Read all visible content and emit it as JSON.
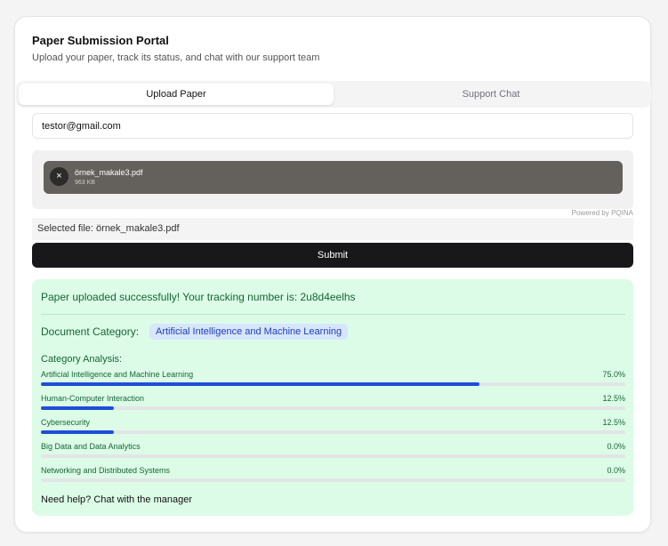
{
  "header": {
    "title": "Paper Submission Portal",
    "subtitle": "Upload your paper, track its status, and chat with our support team"
  },
  "tabs": [
    {
      "label": "Upload Paper",
      "active": true
    },
    {
      "label": "Support Chat",
      "active": false
    }
  ],
  "form": {
    "email_value": "testor@gmail.com",
    "file": {
      "name": "örnek_makale3.pdf",
      "size": "963 KB",
      "remove_icon": "×"
    },
    "powered_by": "Powered by PQINA",
    "selected_file": "Selected file: örnek_makale3.pdf",
    "submit_label": "Submit"
  },
  "result": {
    "success_message": "Paper uploaded successfully! Your tracking number is: 2u8d4eelhs",
    "category_label": "Document Category:",
    "category_value": "Artificial Intelligence and Machine Learning",
    "analysis_label": "Category Analysis:",
    "categories": [
      {
        "name": "Artificial Intelligence and Machine Learning",
        "percent_text": "75.0%",
        "value": 75.0
      },
      {
        "name": "Human-Computer Interaction",
        "percent_text": "12.5%",
        "value": 12.5
      },
      {
        "name": "Cybersecurity",
        "percent_text": "12.5%",
        "value": 12.5
      },
      {
        "name": "Big Data and Data Analytics",
        "percent_text": "0.0%",
        "value": 0.0
      },
      {
        "name": "Networking and Distributed Systems",
        "percent_text": "0.0%",
        "value": 0.0
      }
    ],
    "help_text": "Need help? Chat with the manager"
  },
  "colors": {
    "accent": "#1d4ed8",
    "success_bg": "#dcfce7",
    "success_text": "#166534",
    "button_bg": "#18181b"
  }
}
